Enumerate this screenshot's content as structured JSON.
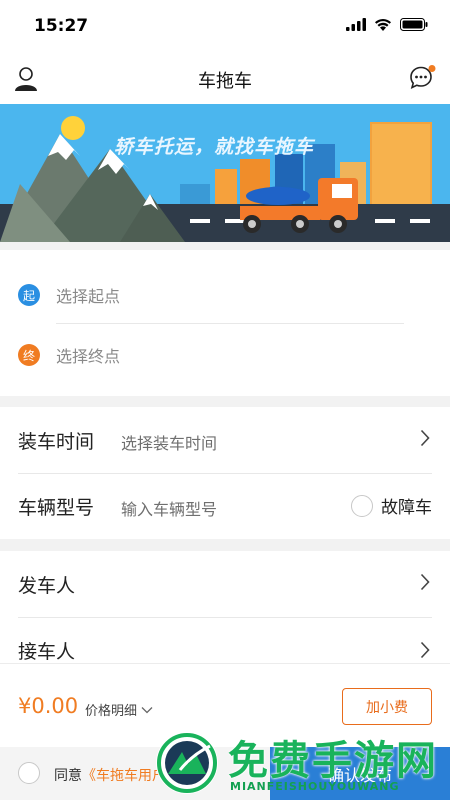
{
  "status_bar": {
    "time": "15:27"
  },
  "header": {
    "title": "车拖车"
  },
  "banner": {
    "slogan": "轿车托运，就找车拖车"
  },
  "route": {
    "start": {
      "badge": "起",
      "placeholder": "选择起点",
      "color": "#2a8fe2"
    },
    "end": {
      "badge": "终",
      "placeholder": "选择终点",
      "color": "#f07c22"
    }
  },
  "form": {
    "load_time": {
      "label": "装车时间",
      "placeholder": "选择装车时间"
    },
    "vehicle_model": {
      "label": "车辆型号",
      "placeholder": "输入车辆型号"
    },
    "fault_vehicle": {
      "label": "故障车",
      "checked": false
    },
    "sender": {
      "label": "发车人"
    },
    "receiver": {
      "label": "接车人"
    }
  },
  "price_bar": {
    "amount": "¥0.00",
    "detail_label": "价格明细",
    "tip_button": "加小费"
  },
  "agreement": {
    "prefix": "同意",
    "link_text": "《车拖车用户协议》"
  },
  "publish_button": "确认发布",
  "watermark": {
    "text": "免费手游网",
    "sub": "MIANFEISHOUYOUWANG"
  },
  "colors": {
    "accent": "#f07c22",
    "primary": "#2a7fd6",
    "unread_dot": "#f07c22"
  }
}
